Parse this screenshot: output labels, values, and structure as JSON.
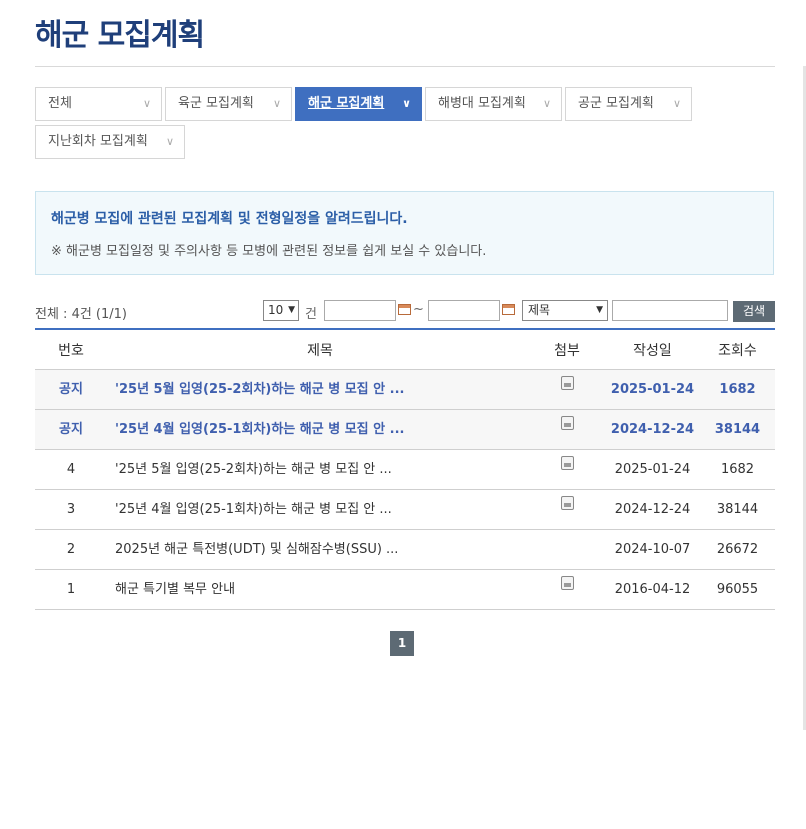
{
  "page": {
    "title": "해군 모집계획"
  },
  "tabs": [
    {
      "label": "전체",
      "active": false
    },
    {
      "label": "육군 모집계획",
      "active": false
    },
    {
      "label": "해군 모집계획",
      "active": true
    },
    {
      "label": "해병대 모집계획",
      "active": false
    },
    {
      "label": "공군 모집계획",
      "active": false
    },
    {
      "label": "지난회차 모집계획",
      "active": false
    }
  ],
  "notice": {
    "line1": "해군병 모집에 관련된 모집계획 및 전형일정을 알려드립니다.",
    "line2": "※ 해군병 모집일정 및 주의사항 등 모병에 관련된 정보를 쉽게 보실 수 있습니다."
  },
  "toolbar": {
    "total": "전체 : 4건 (1/1)",
    "per_page": "10",
    "per_page_unit": "건",
    "tilde": "~",
    "search_field": "제목",
    "search_button": "검색"
  },
  "table": {
    "headers": {
      "no": "번호",
      "title": "제목",
      "attach": "첨부",
      "date": "작성일",
      "views": "조회수"
    },
    "rows": [
      {
        "no": "공지",
        "title": "'25년 5월 입영(25-2회차)하는 해군 병 모집 안 ...",
        "attach": true,
        "date": "2025-01-24",
        "views": "1682",
        "notice": true
      },
      {
        "no": "공지",
        "title": "'25년 4월 입영(25-1회차)하는 해군 병 모집 안 ...",
        "attach": true,
        "date": "2024-12-24",
        "views": "38144",
        "notice": true
      },
      {
        "no": "4",
        "title": "'25년 5월 입영(25-2회차)하는 해군 병 모집 안 ...",
        "attach": true,
        "date": "2025-01-24",
        "views": "1682",
        "notice": false
      },
      {
        "no": "3",
        "title": "'25년 4월 입영(25-1회차)하는 해군 병 모집 안 ...",
        "attach": true,
        "date": "2024-12-24",
        "views": "38144",
        "notice": false
      },
      {
        "no": "2",
        "title": "2025년 해군 특전병(UDT) 및 심해잠수병(SSU) ...",
        "attach": false,
        "date": "2024-10-07",
        "views": "26672",
        "notice": false
      },
      {
        "no": "1",
        "title": "해군 특기별 복무 안내",
        "attach": true,
        "date": "2016-04-12",
        "views": "96055",
        "notice": false
      }
    ]
  },
  "pagination": {
    "current": "1"
  },
  "icons": {
    "chevron": "chevron-down-icon",
    "calendar": "calendar-icon",
    "attachment": "file-icon"
  },
  "colors": {
    "title": "#1f3f7a",
    "active_tab": "#3f6fc0",
    "notice_text": "#2b5ea7",
    "search_button": "#5d6a74"
  }
}
